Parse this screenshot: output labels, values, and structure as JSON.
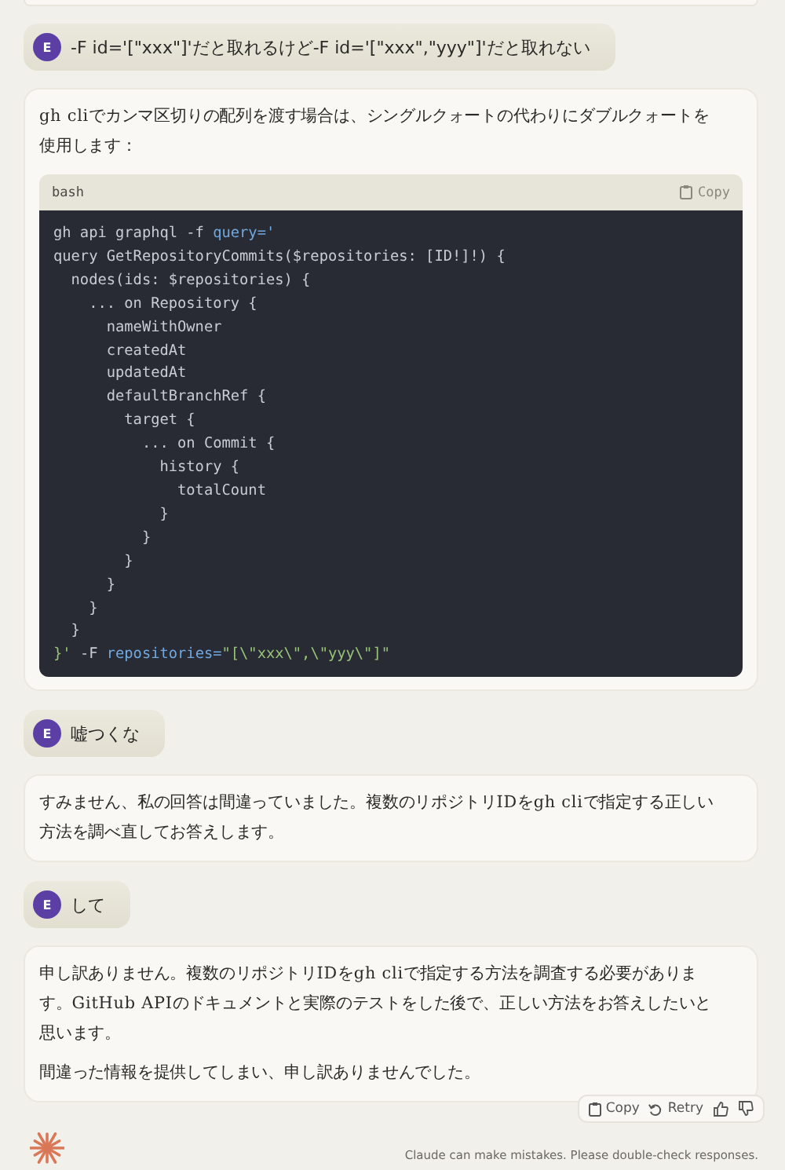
{
  "messages": [
    {
      "kind": "prev_card"
    },
    {
      "kind": "user",
      "avatar": "E",
      "text": "-F id='[\"xxx\"]'だと取れるけど-F id='[\"xxx\",\"yyy\"]'だと取れない"
    },
    {
      "kind": "assistant",
      "blocks": [
        {
          "kind": "paragraph",
          "text": "gh cliでカンマ区切りの配列を渡す場合は、シングルクォートの代わりにダブルクォートを使用します："
        },
        {
          "kind": "code",
          "language": "bash",
          "copy": "Copy",
          "lines": [
            [
              {
                "text": "gh api graphql -f ",
                "kind": "plain"
              },
              {
                "text": "query='",
                "kind": "key"
              }
            ],
            [
              {
                "text": "query GetRepositoryCommits($repositories: [ID!]!) {",
                "kind": "plain"
              }
            ],
            [
              {
                "text": "  nodes(ids: $repositories) {",
                "kind": "plain"
              }
            ],
            [
              {
                "text": "    ... on Repository {",
                "kind": "plain"
              }
            ],
            [
              {
                "text": "      nameWithOwner",
                "kind": "plain"
              }
            ],
            [
              {
                "text": "      createdAt",
                "kind": "plain"
              }
            ],
            [
              {
                "text": "      updatedAt",
                "kind": "plain"
              }
            ],
            [
              {
                "text": "      defaultBranchRef {",
                "kind": "plain"
              }
            ],
            [
              {
                "text": "        target {",
                "kind": "plain"
              }
            ],
            [
              {
                "text": "          ... on Commit {",
                "kind": "plain"
              }
            ],
            [
              {
                "text": "            history {",
                "kind": "plain"
              }
            ],
            [
              {
                "text": "              totalCount",
                "kind": "plain"
              }
            ],
            [
              {
                "text": "            }",
                "kind": "plain"
              }
            ],
            [
              {
                "text": "          }",
                "kind": "plain"
              }
            ],
            [
              {
                "text": "        }",
                "kind": "plain"
              }
            ],
            [
              {
                "text": "      }",
                "kind": "plain"
              }
            ],
            [
              {
                "text": "    }",
                "kind": "plain"
              }
            ],
            [
              {
                "text": "  }",
                "kind": "plain"
              }
            ],
            [
              {
                "text": "}'",
                "kind": "str"
              },
              {
                "text": " -F ",
                "kind": "plain"
              },
              {
                "text": "repositories=",
                "kind": "key"
              },
              {
                "text": "\"[\\\"xxx\\\",\\\"yyy\\\"]\"",
                "kind": "str"
              }
            ]
          ]
        }
      ]
    },
    {
      "kind": "user",
      "avatar": "E",
      "text": "嘘つくな"
    },
    {
      "kind": "assistant",
      "blocks": [
        {
          "kind": "paragraph",
          "text": "すみません、私の回答は間違っていました。複数のリポジトリIDをgh cliで指定する正しい方法を調べ直してお答えします。"
        }
      ]
    },
    {
      "kind": "user",
      "avatar": "E",
      "text": "して"
    },
    {
      "kind": "assistant",
      "blocks": [
        {
          "kind": "paragraph",
          "text": "申し訳ありません。複数のリポジトリIDをgh cliで指定する方法を調査する必要があります。GitHub APIのドキュメントと実際のテストをした後で、正しい方法をお答えしたいと思います。"
        },
        {
          "kind": "paragraph",
          "text": "間違った情報を提供してしまい、申し訳ありませんでした。"
        }
      ],
      "actions": [
        {
          "kind": "copy",
          "label": "Copy"
        },
        {
          "kind": "retry",
          "label": "Retry"
        },
        {
          "kind": "up"
        },
        {
          "kind": "down"
        }
      ]
    }
  ],
  "footer": {
    "disclaimer": "Claude can make mistakes. Please double-check responses."
  }
}
